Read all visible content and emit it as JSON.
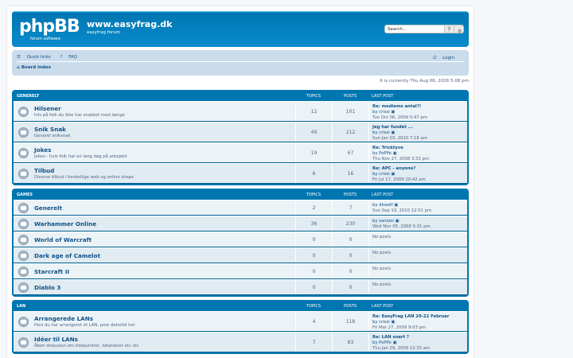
{
  "header": {
    "logo_text": "phpBB",
    "logo_sub": "forum software",
    "site_title": "www.easyfrag.dk",
    "site_desc": "easyfrag forum",
    "search_placeholder": "Search…"
  },
  "nav": {
    "quick_links": "Quick links",
    "faq": "FAQ",
    "login": "Login",
    "board_index": "Board index"
  },
  "time_text": "It is currently Thu Aug 06, 2026 5:08 pm",
  "columns": {
    "topics": "TOPICS",
    "posts": "POSTS",
    "last_post": "LAST POST"
  },
  "categories": [
    {
      "name": "GENERELT",
      "forums": [
        {
          "name": "Hilsener",
          "desc": "hils på folk du ikke har snakket med længe",
          "topics": "12",
          "posts": "101",
          "last_title": "Re: medlems antal?!",
          "last_by": "by crissi",
          "last_date": "Tue Oct 06, 2009 5:47 pm"
        },
        {
          "name": "Snik Snak",
          "desc": "Generel sniksnak",
          "topics": "49",
          "posts": "212",
          "last_title": "Jeg har fundet ...",
          "last_by": "by crissi",
          "last_date": "Sun Jan 03, 2010 7:18 am"
        },
        {
          "name": "Jokes",
          "desc": "Jokes - hvis folk har en lang dag på arbejdet",
          "topics": "19",
          "posts": "67",
          "last_title": "Re: Tricktyve",
          "last_by": "by PoPPe",
          "last_date": "Thu Nov 27, 2008 3:33 pm"
        },
        {
          "name": "Tilbud",
          "desc": "Diverse tilbud i forskellige web og online shops",
          "topics": "6",
          "posts": "16",
          "last_title": "Re: APC - anyone?",
          "last_by": "by crissi",
          "last_date": "Fri Jul 17, 2009 10:42 am"
        }
      ]
    },
    {
      "name": "GAMES",
      "forums": [
        {
          "name": "Generelt",
          "desc": "",
          "topics": "2",
          "posts": "7",
          "last_title": "",
          "last_by": "by dkwolf",
          "last_date": "Sun Sep 19, 2010 12:51 pm"
        },
        {
          "name": "Warhammer Online",
          "desc": "",
          "topics": "36",
          "posts": "230",
          "last_title": "",
          "last_by": "by zanzan",
          "last_date": "Wed Nov 05, 2008 5:31 pm"
        },
        {
          "name": "World of Warcraft",
          "desc": "",
          "topics": "0",
          "posts": "0",
          "last_title": "",
          "last_by": "",
          "last_date": "No posts"
        },
        {
          "name": "Dark age of Camelot",
          "desc": "",
          "topics": "0",
          "posts": "0",
          "last_title": "",
          "last_by": "",
          "last_date": "No posts"
        },
        {
          "name": "Starcraft II",
          "desc": "",
          "topics": "0",
          "posts": "0",
          "last_title": "",
          "last_by": "",
          "last_date": "No posts"
        },
        {
          "name": "Diablo 3",
          "desc": "",
          "topics": "0",
          "posts": "0",
          "last_title": "",
          "last_by": "",
          "last_date": "No posts"
        }
      ]
    },
    {
      "name": "LAN",
      "forums": [
        {
          "name": "Arrangerede LANs",
          "desc": "Hvis du har arrangeret et LAN, post dato/tid her",
          "topics": "4",
          "posts": "118",
          "last_title": "Re: EasyFrag LAN 20-22 Februar",
          "last_by": "by crissi",
          "last_date": "Fri Mar 27, 2009 9:03 pm"
        },
        {
          "name": "Idéer til LANs",
          "desc": "Åben diskusion om tidspunkter, lokationer etc etc",
          "topics": "7",
          "posts": "83",
          "last_title": "Re: LAN snart ?",
          "last_by": "by PoPPe",
          "last_date": "Thu Jan 29, 2009 12:33 am"
        }
      ]
    }
  ]
}
